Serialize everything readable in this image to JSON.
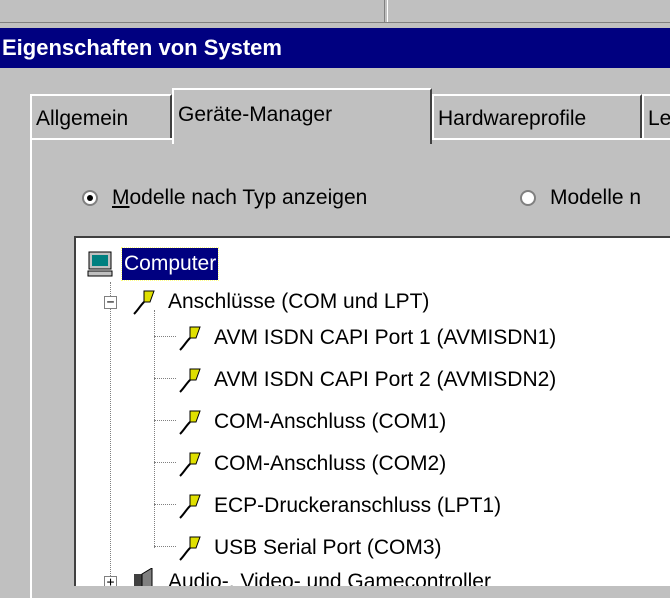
{
  "window_title": "Eigenschaften von System",
  "tabs": [
    {
      "label": "Allgemein"
    },
    {
      "label": "Geräte-Manager"
    },
    {
      "label": "Hardwareprofile"
    },
    {
      "label": "Lei"
    }
  ],
  "view_options": {
    "by_type_prefix": "",
    "by_type_underlined": "M",
    "by_type_rest": "odelle nach Typ anzeigen",
    "by_connection": "Modelle n"
  },
  "tree": {
    "root": "Computer",
    "category": "Anschlüsse (COM und LPT)",
    "children": [
      "AVM ISDN CAPI Port 1 (AVMISDN1)",
      "AVM ISDN CAPI Port 2 (AVMISDN2)",
      "COM-Anschluss (COM1)",
      "COM-Anschluss (COM2)",
      "ECP-Druckeranschluss (LPT1)",
      "USB Serial Port (COM3)"
    ],
    "next_category": "Audio-, Video- und Gamecontroller"
  },
  "icons": {
    "root": "computer-icon",
    "port": "port-connector-icon",
    "audio": "speaker-icon"
  },
  "colors": {
    "titlebar": "#000080",
    "selection": "#000080",
    "face": "#c0c0c0"
  }
}
